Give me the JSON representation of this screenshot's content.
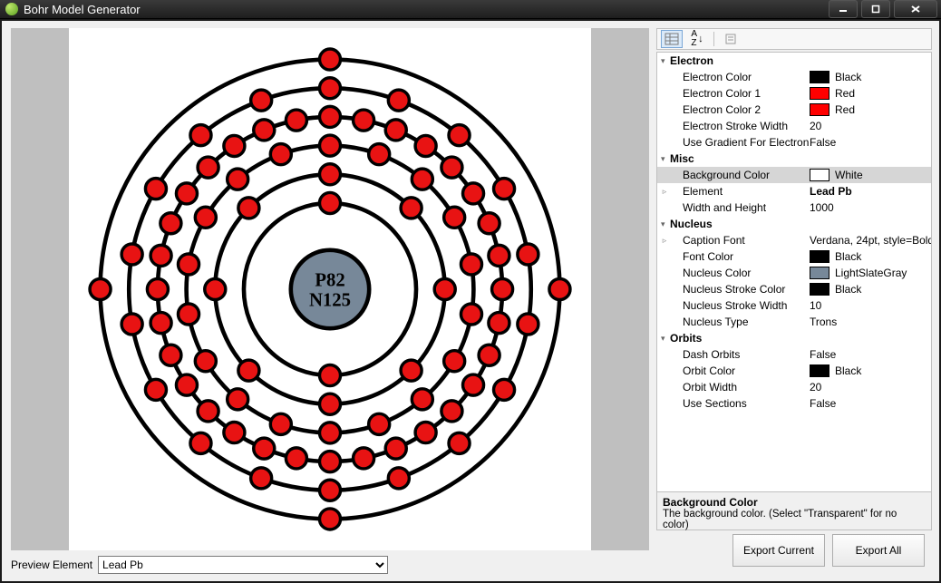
{
  "window": {
    "title": "Bohr Model Generator"
  },
  "preview": {
    "label": "Preview Element",
    "selected": "Lead Pb",
    "options": [
      "Lead Pb"
    ]
  },
  "nucleus_text": {
    "line1": "P82",
    "line2": "N125"
  },
  "property_grid": {
    "toolbar": {
      "mode": "categorized"
    },
    "categories": [
      {
        "name": "Electron",
        "expanded": true,
        "rows": [
          {
            "name": "Electron Color",
            "value": "Black",
            "swatch": "#000000"
          },
          {
            "name": "Electron Color 1",
            "value": "Red",
            "swatch": "#ff0000"
          },
          {
            "name": "Electron Color 2",
            "value": "Red",
            "swatch": "#ff0000"
          },
          {
            "name": "Electron Stroke Width",
            "value": "20"
          },
          {
            "name": "Use Gradient For Electron",
            "value": "False"
          }
        ]
      },
      {
        "name": "Misc",
        "expanded": true,
        "rows": [
          {
            "name": "Background Color",
            "value": "White",
            "swatch": "#ffffff",
            "selected": true
          },
          {
            "name": "Element",
            "value": "Lead Pb",
            "bold": true,
            "expandable": true
          },
          {
            "name": "Width and Height",
            "value": "1000"
          }
        ]
      },
      {
        "name": "Nucleus",
        "expanded": true,
        "rows": [
          {
            "name": "Caption Font",
            "value": "Verdana, 24pt, style=Bold",
            "expandable": true
          },
          {
            "name": "Font Color",
            "value": "Black",
            "swatch": "#000000"
          },
          {
            "name": "Nucleus Color",
            "value": "LightSlateGray",
            "swatch": "#778899"
          },
          {
            "name": "Nucleus Stroke Color",
            "value": "Black",
            "swatch": "#000000"
          },
          {
            "name": "Nucleus Stroke Width",
            "value": "10"
          },
          {
            "name": "Nucleus Type",
            "value": "Trons"
          }
        ]
      },
      {
        "name": "Orbits",
        "expanded": true,
        "rows": [
          {
            "name": "Dash Orbits",
            "value": "False"
          },
          {
            "name": "Orbit Color",
            "value": "Black",
            "swatch": "#000000"
          },
          {
            "name": "Orbit Width",
            "value": "20"
          },
          {
            "name": "Use Sections",
            "value": "False"
          }
        ]
      }
    ],
    "description": {
      "title": "Background Color",
      "text": "The background color. (Select \"Transparent\" for no color)"
    }
  },
  "buttons": {
    "export_current": "Export Current",
    "export_all": "Export All"
  },
  "colors": {
    "electron_fill": "#e81313",
    "electron_stroke": "#000000",
    "orbit": "#000000",
    "nucleus_fill": "#778899",
    "nucleus_stroke": "#000000",
    "background": "#ffffff"
  },
  "shells": {
    "center": 500,
    "size": 1000,
    "nucleus_r": 75,
    "rings": [
      {
        "r": 165,
        "count": 2
      },
      {
        "r": 220,
        "count": 8
      },
      {
        "r": 275,
        "count": 18
      },
      {
        "r": 330,
        "count": 32
      },
      {
        "r": 385,
        "count": 18
      },
      {
        "r": 440,
        "count": 4
      }
    ],
    "electron_r": 20
  }
}
